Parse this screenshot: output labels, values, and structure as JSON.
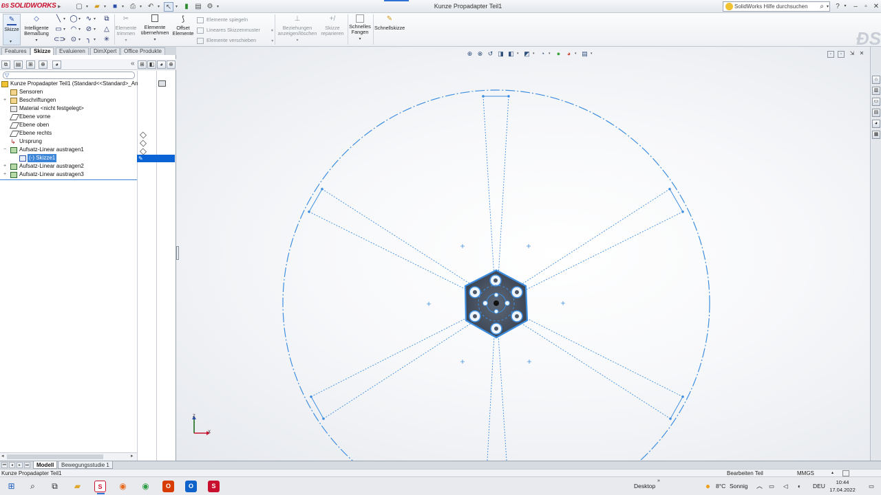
{
  "app": {
    "brand": "SOLIDWORKS",
    "window_title": "Kunze Propadapter Teil1",
    "search_placeholder": "SolidWorks Hilfe durchsuchen"
  },
  "ribbon": {
    "skizze": "Skizze",
    "smart_dim_1": "Intelligente",
    "smart_dim_2": "Bemaßung",
    "trim_1": "Elemente",
    "trim_2": "trimmen",
    "convert_1": "Elemente",
    "convert_2": "übernehmen",
    "offset_1": "Offset",
    "offset_2": "Elemente",
    "mirror": "Elemente spiegeln",
    "pattern": "Lineares Skizzenmuster",
    "move": "Elemente verschieben",
    "relations_1": "Beziehungen",
    "relations_2": "anzeigen/löschen",
    "repair_1": "Skizze",
    "repair_2": "reparieren",
    "snaps_1": "Schnelles",
    "snaps_2": "Fangen",
    "quick": "Schnellskizze"
  },
  "tabs": {
    "features": "Features",
    "skizze": "Skizze",
    "evaluieren": "Evaluieren",
    "dimxpert": "DimXpert",
    "office": "Office Produkte"
  },
  "tree": {
    "root": "Kunze Propadapter Teil1  (Standard<<Standard>_An",
    "sensoren": "Sensoren",
    "beschriftungen": "Beschriftungen",
    "material": "Material <nicht festgelegt>",
    "ebene_vorne": "Ebene vorne",
    "ebene_oben": "Ebene oben",
    "ebene_rechts": "Ebene rechts",
    "ursprung": "Ursprung",
    "aufsatz1": "Aufsatz-Linear austragen1",
    "skizze1": "(-) Skizze1",
    "aufsatz2": "Aufsatz-Linear austragen2",
    "aufsatz3": "Aufsatz-Linear austragen3"
  },
  "bottom_tabs": {
    "modell": "Modell",
    "bewegung": "Bewegungsstudie 1"
  },
  "status": {
    "left": "Kunze Propadapter Teil1",
    "mode": "Bearbeiten Teil",
    "units": "MMGS"
  },
  "taskbar": {
    "desktop": "Desktop",
    "weather_temp": "8°C",
    "weather_desc": "Sonnig",
    "lang": "DEU",
    "time": "10:44",
    "date": "17.04.2022"
  },
  "triad": {
    "z": "Z",
    "x": "X"
  },
  "colors": {
    "sketch_blue": "#3d8ee0",
    "hub_dark": "#4d5766",
    "selection": "#0a64d6",
    "brand_red": "#c8102e"
  }
}
